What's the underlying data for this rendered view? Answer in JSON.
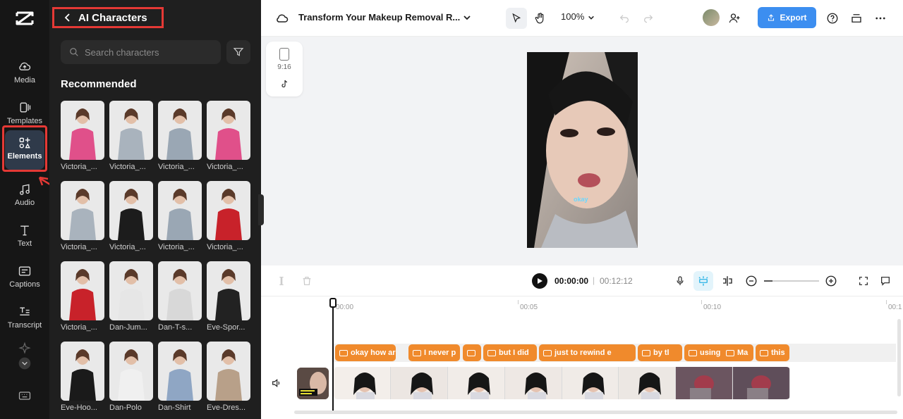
{
  "rail": {
    "items": [
      {
        "label": "Media",
        "icon": "cloud-media-icon"
      },
      {
        "label": "Templates",
        "icon": "templates-icon"
      },
      {
        "label": "Elements",
        "icon": "elements-icon",
        "active": true
      },
      {
        "label": "Audio",
        "icon": "music-note-icon"
      },
      {
        "label": "Text",
        "icon": "text-t-icon"
      },
      {
        "label": "Captions",
        "icon": "captions-icon"
      },
      {
        "label": "Transcript",
        "icon": "transcript-icon"
      }
    ]
  },
  "panel": {
    "title": "AI Characters",
    "search_placeholder": "Search characters",
    "section_title": "Recommended",
    "characters": [
      {
        "label": "Victoria_...",
        "color": "#e0508a"
      },
      {
        "label": "Victoria_...",
        "color": "#a9b3bd"
      },
      {
        "label": "Victoria_...",
        "color": "#9aa7b4"
      },
      {
        "label": "Victoria_...",
        "color": "#e0508a"
      },
      {
        "label": "Victoria_...",
        "color": "#a9b3bd"
      },
      {
        "label": "Victoria_...",
        "color": "#1c1c1c"
      },
      {
        "label": "Victoria_...",
        "color": "#9aa7b4"
      },
      {
        "label": "Victoria_...",
        "color": "#c8222a"
      },
      {
        "label": "Victoria_...",
        "color": "#c8222a"
      },
      {
        "label": "Dan-Jum...",
        "color": "#e6e6e6"
      },
      {
        "label": "Dan-T-s...",
        "color": "#d8d8d8"
      },
      {
        "label": "Eve-Spor...",
        "color": "#222222"
      },
      {
        "label": "Eve-Hoo...",
        "color": "#1a1a1a"
      },
      {
        "label": "Dan-Polo",
        "color": "#f0f0f0"
      },
      {
        "label": "Dan-Shirt",
        "color": "#8fa6c4"
      },
      {
        "label": "Eve-Dres...",
        "color": "#b8a089"
      }
    ]
  },
  "topbar": {
    "project_title": "Transform Your Makeup Removal R...",
    "zoom": "100%",
    "export_label": "Export"
  },
  "canvas": {
    "ratio": "9:16",
    "caption_text": "okay"
  },
  "player": {
    "current_time": "00:00:00",
    "separator": "|",
    "total_time": "00:12:12"
  },
  "timeline": {
    "ticks": [
      "00:00",
      "00:05",
      "00:10",
      "00:1"
    ],
    "captions": [
      "okay how are",
      "I never p",
      "",
      "but I did",
      "just to rewind e",
      "by tl",
      "using Crav",
      "Ma",
      "this"
    ]
  },
  "colors": {
    "accent": "#3c8ef0",
    "caption_clip": "#f08a2c",
    "highlight_red": "#e53935"
  }
}
